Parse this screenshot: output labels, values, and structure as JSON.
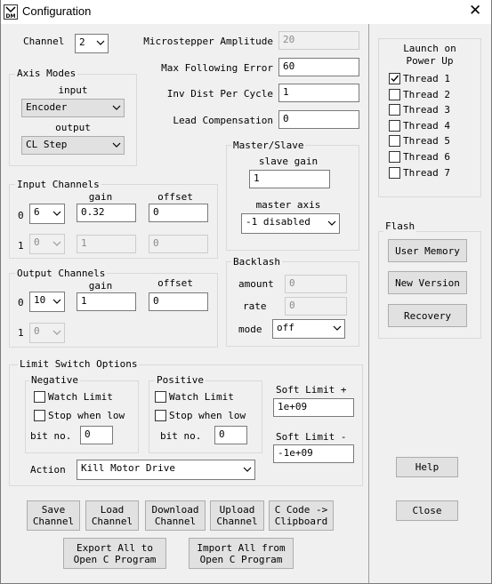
{
  "window": {
    "title": "Configuration",
    "close_glyph": "✕",
    "icon": "app-dm-icon"
  },
  "channel": {
    "label": "Channel",
    "value": "2"
  },
  "microstepper": {
    "label": "Microstepper Amplitude",
    "value": "20"
  },
  "max_following_error": {
    "label": "Max Following Error",
    "value": "60"
  },
  "inv_dist_per_cycle": {
    "label": "Inv Dist Per Cycle",
    "value": "1"
  },
  "lead_compensation": {
    "label": "Lead Compensation",
    "value": "0"
  },
  "axis_modes": {
    "title": "Axis Modes",
    "input_label": "input",
    "input_value": "Encoder",
    "output_label": "output",
    "output_value": "CL Step"
  },
  "master_slave": {
    "title": "Master/Slave",
    "slave_gain_label": "slave gain",
    "slave_gain_value": "1",
    "master_axis_label": "master axis",
    "master_axis_value": "-1 disabled"
  },
  "input_channels": {
    "title": "Input Channels",
    "gain_header": "gain",
    "offset_header": "offset",
    "rows": [
      {
        "index": "0",
        "channel": "6",
        "gain": "0.32",
        "offset": "0"
      },
      {
        "index": "1",
        "channel": "0",
        "gain": "1",
        "offset": "0"
      }
    ]
  },
  "output_channels": {
    "title": "Output Channels",
    "gain_header": "gain",
    "offset_header": "offset",
    "rows": [
      {
        "index": "0",
        "channel": "10",
        "gain": "1",
        "offset": "0"
      },
      {
        "index": "1",
        "channel": "0"
      }
    ]
  },
  "backlash": {
    "title": "Backlash",
    "amount_label": "amount",
    "amount_value": "0",
    "rate_label": "rate",
    "rate_value": "0",
    "mode_label": "mode",
    "mode_value": "off"
  },
  "limit_switch": {
    "title": "Limit Switch Options",
    "negative": {
      "title": "Negative",
      "watch_limit": "Watch Limit",
      "stop_when_low": "Stop when low",
      "bit_no_label": "bit no.",
      "bit_no_value": "0"
    },
    "positive": {
      "title": "Positive",
      "watch_limit": "Watch Limit",
      "stop_when_low": "Stop when low",
      "bit_no_label": "bit no.",
      "bit_no_value": "0"
    },
    "soft_limit_plus_label": "Soft Limit +",
    "soft_limit_plus_value": "1e+09",
    "soft_limit_minus_label": "Soft Limit -",
    "soft_limit_minus_value": "-1e+09",
    "action_label": "Action",
    "action_value": "Kill Motor Drive"
  },
  "launch": {
    "title_line1": "Launch on",
    "title_line2": "Power Up",
    "threads": [
      {
        "label": "Thread 1",
        "checked": true
      },
      {
        "label": "Thread 2",
        "checked": false
      },
      {
        "label": "Thread 3",
        "checked": false
      },
      {
        "label": "Thread 4",
        "checked": false
      },
      {
        "label": "Thread 5",
        "checked": false
      },
      {
        "label": "Thread 6",
        "checked": false
      },
      {
        "label": "Thread 7",
        "checked": false
      }
    ]
  },
  "flash": {
    "title": "Flash",
    "user_memory": "User Memory",
    "new_version": "New Version",
    "recovery": "Recovery"
  },
  "buttons": {
    "help": "Help",
    "close": "Close",
    "save_channel": "Save\nChannel",
    "load_channel": "Load\nChannel",
    "download_channel": "Download\nChannel",
    "upload_channel": "Upload\nChannel",
    "c_code_clipboard": "C Code ->\nClipboard",
    "export_all": "Export All to\nOpen C Program",
    "import_all": "Import All from\nOpen C Program"
  }
}
